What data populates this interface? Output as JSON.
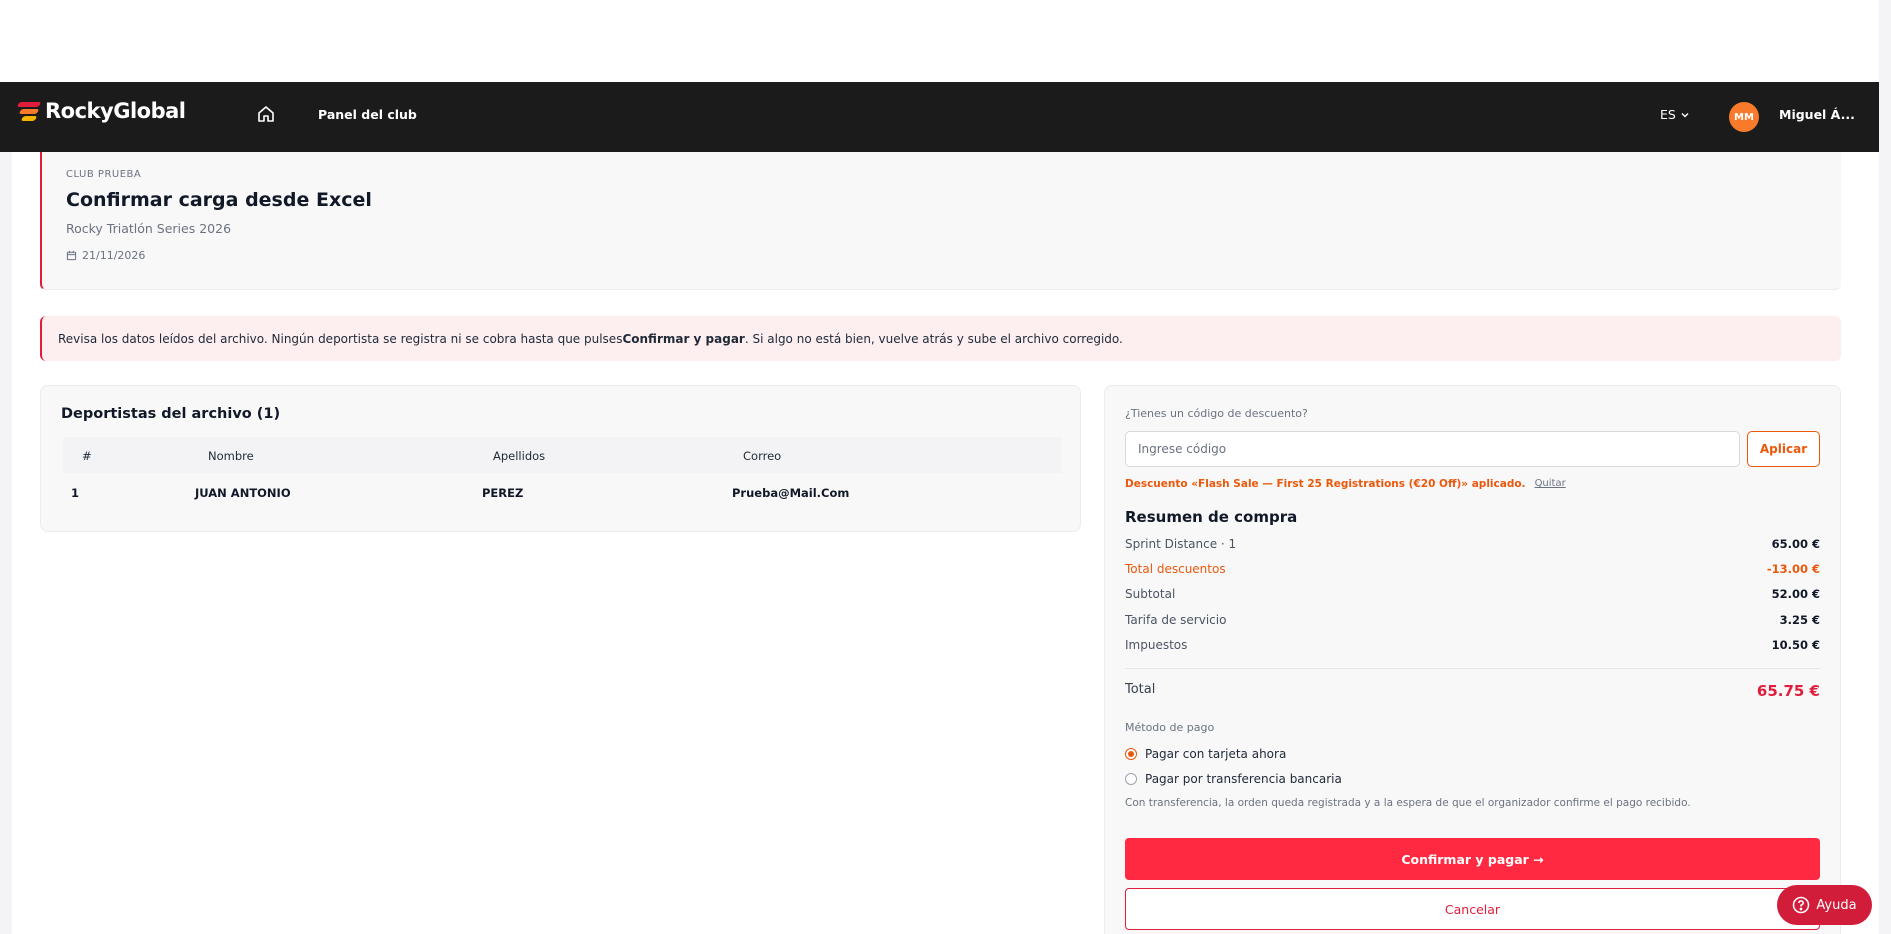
{
  "brand": {
    "name": "RockyGlobal",
    "logo_colors": [
      "#e11d3c",
      "#f97a2b",
      "#f4b400"
    ]
  },
  "nav": {
    "home_icon": "home-icon",
    "panel_link": "Panel del club",
    "language": "ES",
    "user_initials": "MM",
    "user_name": "Miguel Á..."
  },
  "header": {
    "club": "CLUB PRUEBA",
    "title": "Confirmar carga desde Excel",
    "event": "Rocky Triatlón Series 2026",
    "date": "21/11/2026"
  },
  "notice": {
    "before": "Revisa los datos leídos del archivo. Ningún deportista se registra ni se cobra hasta que pulses ",
    "bold": "Confirmar y pagar",
    "after": ". Si algo no está bien, vuelve atrás y sube el archivo corregido."
  },
  "athletes": {
    "title": "Deportistas del archivo (1)",
    "columns": [
      "#",
      "Nombre",
      "Apellidos",
      "Correo"
    ],
    "rows": [
      {
        "num": "1",
        "nombre": "JUAN ANTONIO",
        "apellidos": "PEREZ",
        "correo": "Prueba@Mail.Com"
      }
    ]
  },
  "discount": {
    "question": "¿Tienes un código de descuento?",
    "placeholder": "Ingrese código",
    "apply_label": "Aplicar",
    "applied_text": "Descuento «Flash Sale — First 25 Registrations (€20 Off)» aplicado.",
    "remove_label": "Quitar"
  },
  "summary": {
    "title": "Resumen de compra",
    "lines": [
      {
        "label": "Sprint Distance · 1",
        "value": "65.00 €"
      },
      {
        "label": "Total descuentos",
        "value": "-13.00 €"
      },
      {
        "label": "Subtotal",
        "value": "52.00 €"
      },
      {
        "label": "Tarifa de servicio",
        "value": "3.25 €"
      },
      {
        "label": "Impuestos",
        "value": "10.50 €"
      }
    ],
    "total_label": "Total",
    "total_value": "65.75 €"
  },
  "payment": {
    "label": "Método de pago",
    "options": [
      "Pagar con tarjeta ahora",
      "Pagar por transferencia bancaria"
    ],
    "selected_index": 0,
    "transfer_note": "Con transferencia, la orden queda registrada y a la espera de que el organizador confirme el pago recibido."
  },
  "actions": {
    "confirm": "Confirmar y pagar →",
    "cancel": "Cancelar"
  },
  "help": {
    "label": "Ayuda"
  }
}
